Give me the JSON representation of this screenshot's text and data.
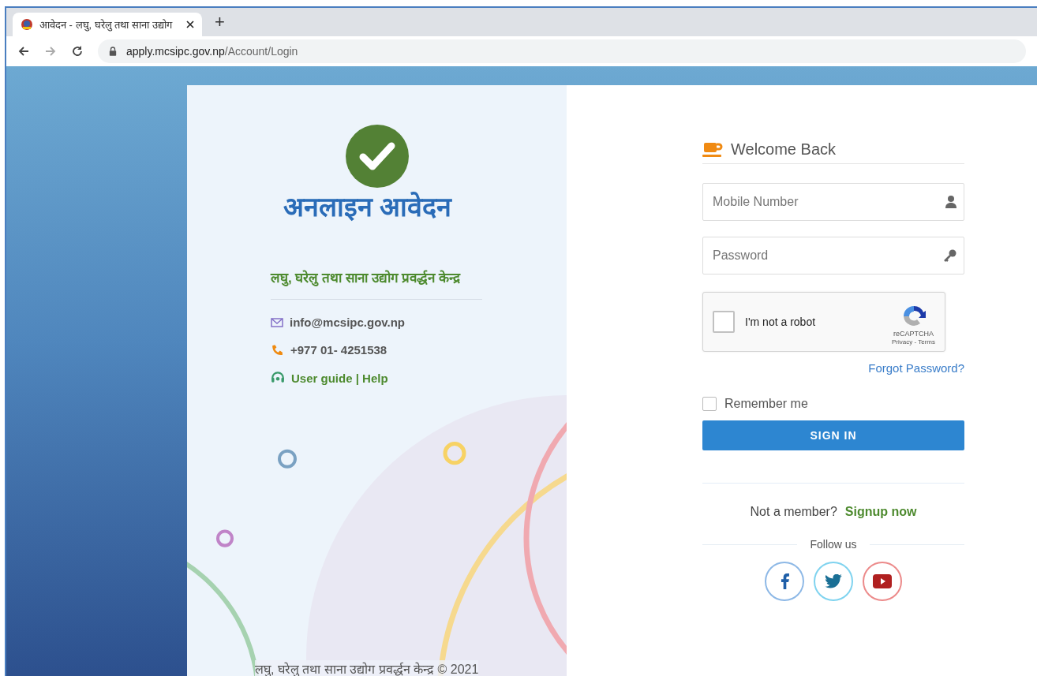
{
  "browser": {
    "tabs": [
      {
        "title": "आवेदन - लघु, घरेलु तथा साना उद्योग",
        "selected": true
      }
    ],
    "new_tab": "+",
    "url": {
      "host": "apply.mcsipc.gov.np",
      "path": "/Account/Login"
    }
  },
  "brand": {
    "title": "अनलाइन आवेदन",
    "organization": "लघु, घरेलु तथा साना उद्योग प्रवर्द्धन केन्द्र",
    "contacts": [
      {
        "kind": "email",
        "text": "info@mcsipc.gov.np"
      },
      {
        "kind": "phone",
        "text": "+977 01- 4251538"
      },
      {
        "kind": "help",
        "text": "User guide | Help"
      }
    ],
    "footer": "लघु, घरेलु तथा साना उद्योग प्रवर्द्धन केन्द्र © 2021"
  },
  "login": {
    "heading": "Welcome Back",
    "fields": [
      {
        "kind": "user",
        "placeholder": "Mobile Number"
      },
      {
        "kind": "key",
        "placeholder": "Password"
      }
    ],
    "captcha": {
      "label": "I'm not a robot",
      "checked": false,
      "brand": "reCAPTCHA",
      "links": "Privacy - Terms"
    },
    "forgot": "Forgot Password?",
    "remember": {
      "label": "Remember me",
      "checked": false
    },
    "submit": "SIGN IN",
    "signup_prompt": "Not a member?",
    "signup_link": "Signup now",
    "follow": "Follow us",
    "social": [
      {
        "kind": "facebook",
        "color": "#8db8e6"
      },
      {
        "kind": "twitter",
        "color": "#7fd3ef"
      },
      {
        "kind": "youtube",
        "color": "#ec8a8a"
      }
    ]
  }
}
